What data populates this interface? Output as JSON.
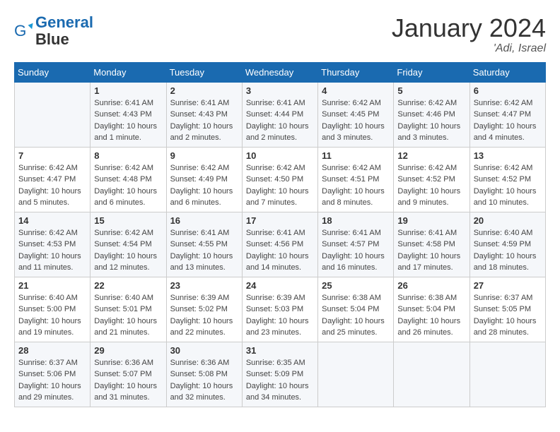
{
  "header": {
    "logo_line1": "General",
    "logo_line2": "Blue",
    "month": "January 2024",
    "location": "'Adi, Israel"
  },
  "days_of_week": [
    "Sunday",
    "Monday",
    "Tuesday",
    "Wednesday",
    "Thursday",
    "Friday",
    "Saturday"
  ],
  "weeks": [
    [
      {
        "day": "",
        "info": ""
      },
      {
        "day": "1",
        "info": "Sunrise: 6:41 AM\nSunset: 4:43 PM\nDaylight: 10 hours\nand 1 minute."
      },
      {
        "day": "2",
        "info": "Sunrise: 6:41 AM\nSunset: 4:43 PM\nDaylight: 10 hours\nand 2 minutes."
      },
      {
        "day": "3",
        "info": "Sunrise: 6:41 AM\nSunset: 4:44 PM\nDaylight: 10 hours\nand 2 minutes."
      },
      {
        "day": "4",
        "info": "Sunrise: 6:42 AM\nSunset: 4:45 PM\nDaylight: 10 hours\nand 3 minutes."
      },
      {
        "day": "5",
        "info": "Sunrise: 6:42 AM\nSunset: 4:46 PM\nDaylight: 10 hours\nand 3 minutes."
      },
      {
        "day": "6",
        "info": "Sunrise: 6:42 AM\nSunset: 4:47 PM\nDaylight: 10 hours\nand 4 minutes."
      }
    ],
    [
      {
        "day": "7",
        "info": "Sunrise: 6:42 AM\nSunset: 4:47 PM\nDaylight: 10 hours\nand 5 minutes."
      },
      {
        "day": "8",
        "info": "Sunrise: 6:42 AM\nSunset: 4:48 PM\nDaylight: 10 hours\nand 6 minutes."
      },
      {
        "day": "9",
        "info": "Sunrise: 6:42 AM\nSunset: 4:49 PM\nDaylight: 10 hours\nand 6 minutes."
      },
      {
        "day": "10",
        "info": "Sunrise: 6:42 AM\nSunset: 4:50 PM\nDaylight: 10 hours\nand 7 minutes."
      },
      {
        "day": "11",
        "info": "Sunrise: 6:42 AM\nSunset: 4:51 PM\nDaylight: 10 hours\nand 8 minutes."
      },
      {
        "day": "12",
        "info": "Sunrise: 6:42 AM\nSunset: 4:52 PM\nDaylight: 10 hours\nand 9 minutes."
      },
      {
        "day": "13",
        "info": "Sunrise: 6:42 AM\nSunset: 4:52 PM\nDaylight: 10 hours\nand 10 minutes."
      }
    ],
    [
      {
        "day": "14",
        "info": "Sunrise: 6:42 AM\nSunset: 4:53 PM\nDaylight: 10 hours\nand 11 minutes."
      },
      {
        "day": "15",
        "info": "Sunrise: 6:42 AM\nSunset: 4:54 PM\nDaylight: 10 hours\nand 12 minutes."
      },
      {
        "day": "16",
        "info": "Sunrise: 6:41 AM\nSunset: 4:55 PM\nDaylight: 10 hours\nand 13 minutes."
      },
      {
        "day": "17",
        "info": "Sunrise: 6:41 AM\nSunset: 4:56 PM\nDaylight: 10 hours\nand 14 minutes."
      },
      {
        "day": "18",
        "info": "Sunrise: 6:41 AM\nSunset: 4:57 PM\nDaylight: 10 hours\nand 16 minutes."
      },
      {
        "day": "19",
        "info": "Sunrise: 6:41 AM\nSunset: 4:58 PM\nDaylight: 10 hours\nand 17 minutes."
      },
      {
        "day": "20",
        "info": "Sunrise: 6:40 AM\nSunset: 4:59 PM\nDaylight: 10 hours\nand 18 minutes."
      }
    ],
    [
      {
        "day": "21",
        "info": "Sunrise: 6:40 AM\nSunset: 5:00 PM\nDaylight: 10 hours\nand 19 minutes."
      },
      {
        "day": "22",
        "info": "Sunrise: 6:40 AM\nSunset: 5:01 PM\nDaylight: 10 hours\nand 21 minutes."
      },
      {
        "day": "23",
        "info": "Sunrise: 6:39 AM\nSunset: 5:02 PM\nDaylight: 10 hours\nand 22 minutes."
      },
      {
        "day": "24",
        "info": "Sunrise: 6:39 AM\nSunset: 5:03 PM\nDaylight: 10 hours\nand 23 minutes."
      },
      {
        "day": "25",
        "info": "Sunrise: 6:38 AM\nSunset: 5:04 PM\nDaylight: 10 hours\nand 25 minutes."
      },
      {
        "day": "26",
        "info": "Sunrise: 6:38 AM\nSunset: 5:04 PM\nDaylight: 10 hours\nand 26 minutes."
      },
      {
        "day": "27",
        "info": "Sunrise: 6:37 AM\nSunset: 5:05 PM\nDaylight: 10 hours\nand 28 minutes."
      }
    ],
    [
      {
        "day": "28",
        "info": "Sunrise: 6:37 AM\nSunset: 5:06 PM\nDaylight: 10 hours\nand 29 minutes."
      },
      {
        "day": "29",
        "info": "Sunrise: 6:36 AM\nSunset: 5:07 PM\nDaylight: 10 hours\nand 31 minutes."
      },
      {
        "day": "30",
        "info": "Sunrise: 6:36 AM\nSunset: 5:08 PM\nDaylight: 10 hours\nand 32 minutes."
      },
      {
        "day": "31",
        "info": "Sunrise: 6:35 AM\nSunset: 5:09 PM\nDaylight: 10 hours\nand 34 minutes."
      },
      {
        "day": "",
        "info": ""
      },
      {
        "day": "",
        "info": ""
      },
      {
        "day": "",
        "info": ""
      }
    ]
  ]
}
